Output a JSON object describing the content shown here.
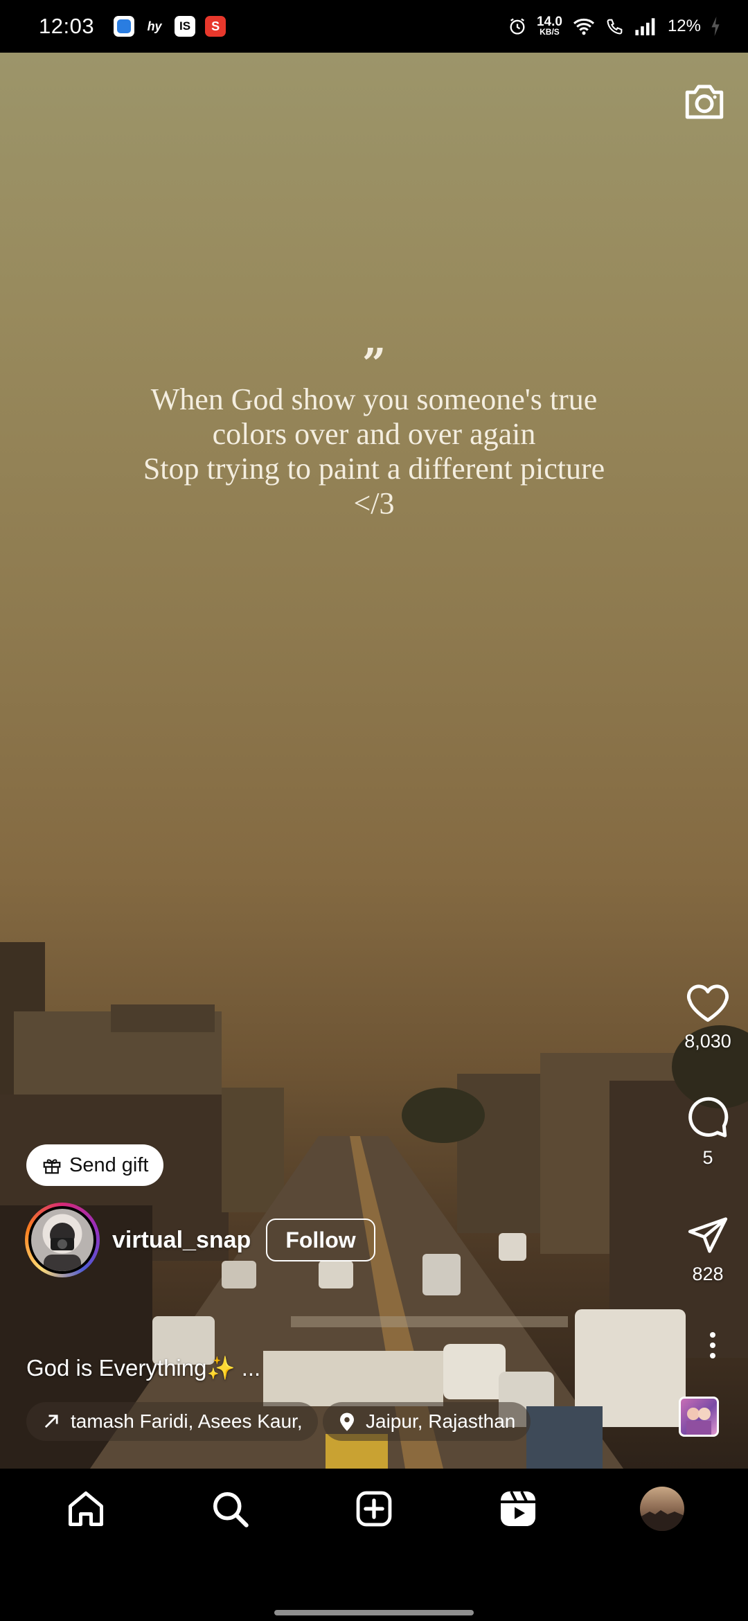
{
  "status_bar": {
    "time": "12:03",
    "net_speed_value": "14.0",
    "net_speed_unit": "KB/S",
    "battery": "12%",
    "app_icons": [
      "blue-app-icon",
      "hy-app-icon",
      "is-app-icon",
      "s-app-icon"
    ]
  },
  "reel": {
    "quote_mark": "”",
    "quote_lines": [
      "When God show you someone's true",
      "colors over and over again",
      "Stop trying to paint a different picture",
      "</3"
    ]
  },
  "actions": {
    "likes": "8,030",
    "comments": "5",
    "shares": "828"
  },
  "post": {
    "gift_label": "Send gift",
    "username": "virtual_snap",
    "follow_label": "Follow",
    "caption": "God is Everything✨ ...",
    "audio": "tamash Faridi, Asees Kaur,",
    "location": "Jaipur, Rajasthan"
  },
  "nav": {
    "items": [
      "home-icon",
      "search-icon",
      "create-icon",
      "reels-icon",
      "profile-avatar"
    ]
  },
  "colors": {
    "accent_white": "#ffffff",
    "nav_bg": "#000000"
  }
}
